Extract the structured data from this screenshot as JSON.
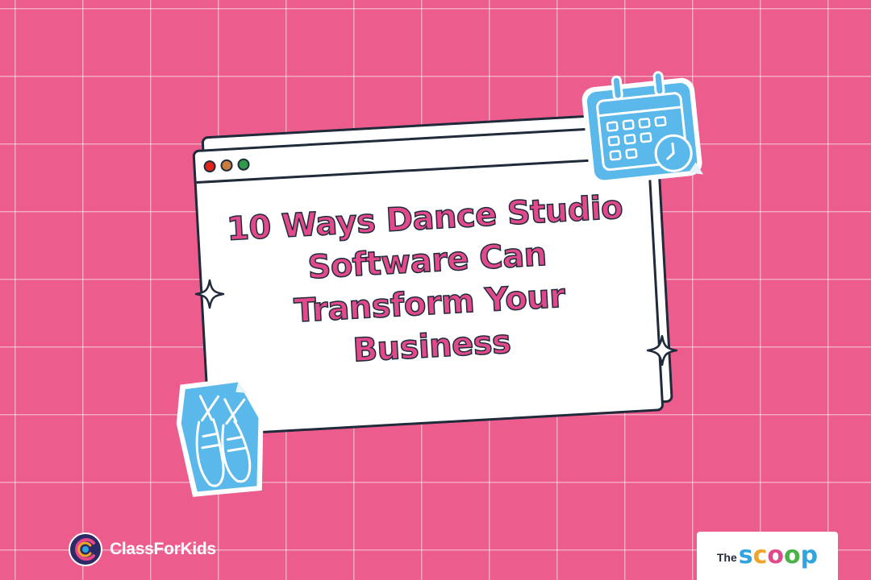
{
  "headline": {
    "lines": [
      "10 Ways Dance Studio",
      "Software Can",
      "Transform Your",
      "Business"
    ]
  },
  "browser_window": {
    "dots": [
      {
        "name": "red",
        "color": "#e2231a"
      },
      {
        "name": "amber",
        "color": "#c97d3d"
      },
      {
        "name": "green",
        "color": "#2f9a4a"
      }
    ]
  },
  "stickers": {
    "calendar": {
      "icon": "calendar-clock-icon",
      "color": "#5ab8ea"
    },
    "ballet_shoes": {
      "icon": "ballet-shoes-icon",
      "color": "#5ab8ea"
    }
  },
  "logos": {
    "left": {
      "text": "ClassForKids",
      "icon": "classforkids-logo-icon"
    },
    "right": {
      "small_text": "The",
      "letters": [
        {
          "char": "s",
          "color": "#2fa4e0"
        },
        {
          "char": "c",
          "color": "#f0a52a"
        },
        {
          "char": "o",
          "color": "#e0498a"
        },
        {
          "char": "o",
          "color": "#49b34a"
        },
        {
          "char": "p",
          "color": "#2fa4e0"
        }
      ]
    }
  },
  "colors": {
    "background": "#ec5c8c",
    "headline": "#e0498a",
    "outline": "#1f2a3a",
    "sticker": "#5ab8ea"
  }
}
